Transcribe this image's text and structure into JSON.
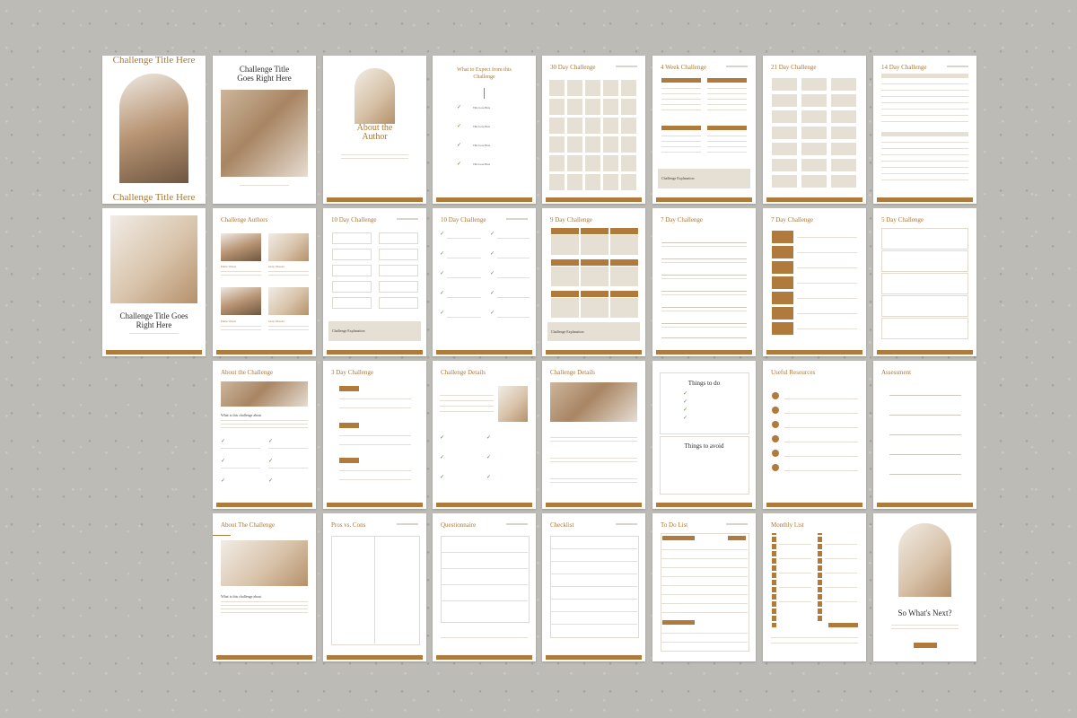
{
  "colors": {
    "accent": "#b07a3c",
    "background": "#bdbbb5",
    "page": "#ffffff",
    "beige": "#e6dfd4"
  },
  "p1": {
    "top": "Challenge Title Here",
    "bottom": "Challenge Title Here"
  },
  "p2": {
    "title": "Challenge Title Goes Right Here"
  },
  "p3": {
    "title": "About the Author"
  },
  "p4": {
    "title": "What to Expect from this Challenge",
    "items": [
      "Title Goes Here",
      "Title Goes Here",
      "Title Goes Here",
      "Title Goes Here"
    ]
  },
  "p5": {
    "title": "30 Day Challenge"
  },
  "p6": {
    "title": "4 Week Challenge",
    "note": "Challenge Explanation"
  },
  "p7": {
    "title": "21 Day Challenge"
  },
  "p8": {
    "title": "14 Day Challenge"
  },
  "p9": {
    "title": "Challenge Title Goes Right Here"
  },
  "p10": {
    "title": "Challenge Authors",
    "names": [
      "Emma Wilson",
      "Jenny Wheeler",
      "Emma Wilson",
      "Jenny Wheeler"
    ]
  },
  "p11": {
    "title": "10 Day Challenge",
    "note": "Challenge Explanation"
  },
  "p12": {
    "title": "10 Day Challenge"
  },
  "p13": {
    "title": "9 Day Challenge",
    "note": "Challenge Explanation"
  },
  "p14": {
    "title": "7 Day Challenge"
  },
  "p15": {
    "title": "7 Day Challenge"
  },
  "p16": {
    "title": "5 Day Challenge"
  },
  "p17": {
    "title": "About the Challenge",
    "sub": "What is this challenge about"
  },
  "p18": {
    "title": "3 Day Challenge"
  },
  "p19": {
    "title": "Challenge Details"
  },
  "p20": {
    "title": "Challenge Details"
  },
  "p21": {
    "todo": "Things to do",
    "avoid": "Things to avoid"
  },
  "p22": {
    "title": "Useful Resources"
  },
  "p23": {
    "title": "Assessment"
  },
  "p24": {
    "title": "About The Challenge",
    "sub": "What is this challenge about"
  },
  "p25": {
    "title": "Pros vs. Cons"
  },
  "p26": {
    "title": "Questionnaire"
  },
  "p27": {
    "title": "Checklist"
  },
  "p28": {
    "title": "To Do List"
  },
  "p29": {
    "title": "Monthly List"
  },
  "p30": {
    "title": "So What's Next?"
  }
}
